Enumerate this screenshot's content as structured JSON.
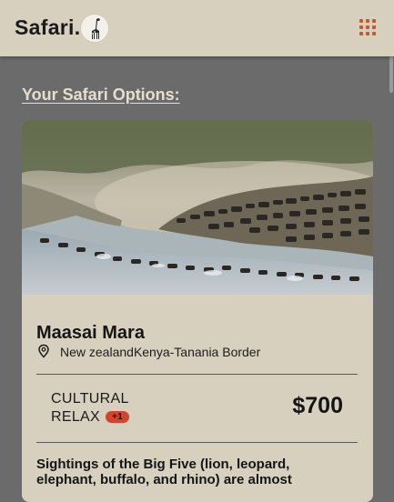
{
  "header": {
    "logo_text": "Safari.",
    "logo_icon": "giraffe-icon",
    "menu_icon": "grid-menu-icon",
    "accent_color": "#c65a2b"
  },
  "section": {
    "title": "Your Safari Options:"
  },
  "card": {
    "image_alt": "wildebeest-migration-river-crossing",
    "title": "Maasai Mara",
    "location_icon": "location-pin-icon",
    "location": "New zealandKenya-Tanania Border",
    "tag_1": "CULTURAL",
    "tag_2": "RELAX",
    "extra_tags": "+1",
    "price": "$700",
    "description": "Sightings of the Big Five (lion, leopard, elephant, buffalo, and rhino) are almost"
  }
}
